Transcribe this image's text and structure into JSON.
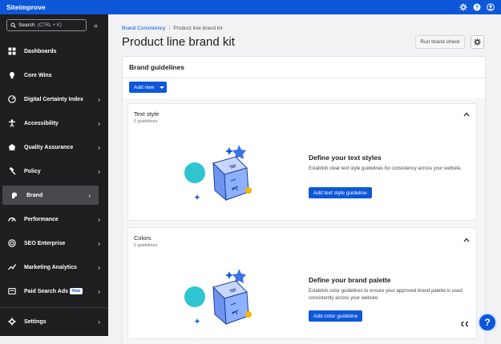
{
  "app": {
    "brand": "Siteimprove"
  },
  "search": {
    "label": "Search",
    "shortcut": "(CTRL + K)"
  },
  "sidebar": {
    "items": [
      {
        "label": "Dashboards",
        "icon": "grid-icon",
        "chevron": false
      },
      {
        "label": "Core Wins",
        "icon": "lightbulb-icon",
        "chevron": false
      },
      {
        "label": "Digital Certainty Index",
        "icon": "gauge-icon",
        "chevron": true
      },
      {
        "label": "Accessibility",
        "icon": "accessibility-icon",
        "chevron": true
      },
      {
        "label": "Quality Assurance",
        "icon": "quality-icon",
        "chevron": true
      },
      {
        "label": "Policy",
        "icon": "gavel-icon",
        "chevron": true
      },
      {
        "label": "Brand",
        "icon": "brand-icon",
        "chevron": true,
        "active": true
      },
      {
        "label": "Performance",
        "icon": "speedometer-icon",
        "chevron": true
      },
      {
        "label": "SEO Enterprise",
        "icon": "target-icon",
        "chevron": true
      },
      {
        "label": "Marketing Analytics",
        "icon": "analytics-icon",
        "chevron": true
      },
      {
        "label": "Paid Search Ads",
        "icon": "ads-icon",
        "chevron": true,
        "badge": "New"
      }
    ],
    "settings": "Settings"
  },
  "breadcrumb": {
    "parent": "Brand Consistency",
    "current": "Product line brand kit"
  },
  "page": {
    "title": "Product line brand kit",
    "run_check": "Run brand check"
  },
  "guidelines": {
    "title": "Brand guidelines",
    "add_new": "Add new",
    "sections": [
      {
        "title": "Text style",
        "count": "0 guidelines",
        "empty_title": "Define your text styles",
        "empty_desc": "Establish clear text style guidelines for consistency across your website.",
        "cta": "Add text style guideline"
      },
      {
        "title": "Colors",
        "count": "0 guidelines",
        "empty_title": "Define your brand palette",
        "empty_desc": "Establish color guidelines to ensure your approved brand palette is used consistently across your website.",
        "cta": "Add color guideline"
      }
    ]
  },
  "floating": {
    "captions": "CC",
    "help": "?"
  },
  "colors": {
    "primary": "#0d57d8",
    "sidebar": "#1f1f22",
    "active": "#48494d",
    "teal": "#2ec4d0",
    "gold": "#f5b800"
  }
}
